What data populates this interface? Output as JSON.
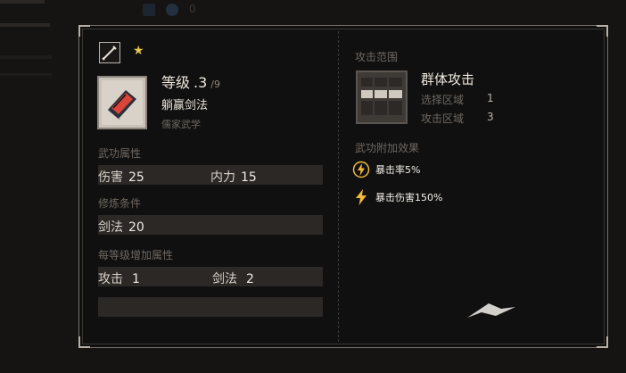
{
  "tooltip": {
    "level_label": "等级",
    "level_value": ".3",
    "level_max": "/9",
    "skill_name": "躺赢剑法",
    "school": "儒家武学",
    "sections": {
      "attributes_title": "武功属性",
      "requirements_title": "修炼条件",
      "per_level_title": "每等级增加属性"
    },
    "attributes": [
      {
        "label": "伤害",
        "value": "25"
      },
      {
        "label": "内力",
        "value": "15"
      }
    ],
    "requirements": [
      {
        "label": "剑法",
        "value": "20"
      }
    ],
    "per_level": [
      {
        "label": "攻击",
        "value": "1"
      },
      {
        "label": "剑法",
        "value": "2"
      }
    ],
    "range": {
      "title": "攻击范围",
      "name": "群体攻击",
      "select_label": "选择区域",
      "select_value": "1",
      "attack_label": "攻击区域",
      "attack_value": "3"
    },
    "effects_title": "武功附加效果",
    "effects": [
      {
        "text": "暴击率5%",
        "icon": "lightning-circle-icon"
      },
      {
        "text": "暴击伤害150%",
        "icon": "lightning-icon"
      }
    ]
  },
  "background": {
    "counter_value": "0"
  },
  "colors": {
    "accent_gold": "#e6c54a",
    "lightning": "#f0b93a",
    "panel_bg": "#111010",
    "stat_bar": "#2b2826"
  }
}
